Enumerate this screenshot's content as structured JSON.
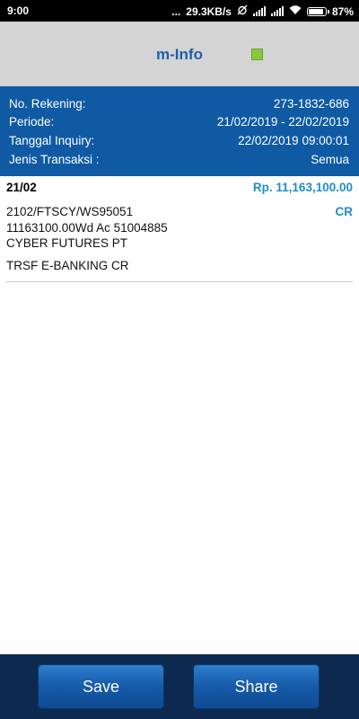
{
  "statusbar": {
    "time": "9:00",
    "dots": "...",
    "speed": "29.3KB/s",
    "battery": "87%"
  },
  "header": {
    "title": "m-Info"
  },
  "info": {
    "rows": [
      {
        "label": "No. Rekening:",
        "value": "273-1832-686"
      },
      {
        "label": "Periode:",
        "value": "21/02/2019 - 22/02/2019"
      },
      {
        "label": "Tanggal Inquiry:",
        "value": "22/02/2019 09:00:01"
      },
      {
        "label": "Jenis Transaksi :",
        "value": "Semua"
      }
    ]
  },
  "transaction": {
    "date": "21/02",
    "amount": "Rp. 11,163,100.00",
    "type": "CR",
    "lines": [
      "2102/FTSCY/WS95051",
      "11163100.00Wd Ac 51004885",
      "CYBER FUTURES PT"
    ],
    "description": "TRSF E-BANKING CR"
  },
  "footer": {
    "save_label": "Save",
    "share_label": "Share"
  }
}
